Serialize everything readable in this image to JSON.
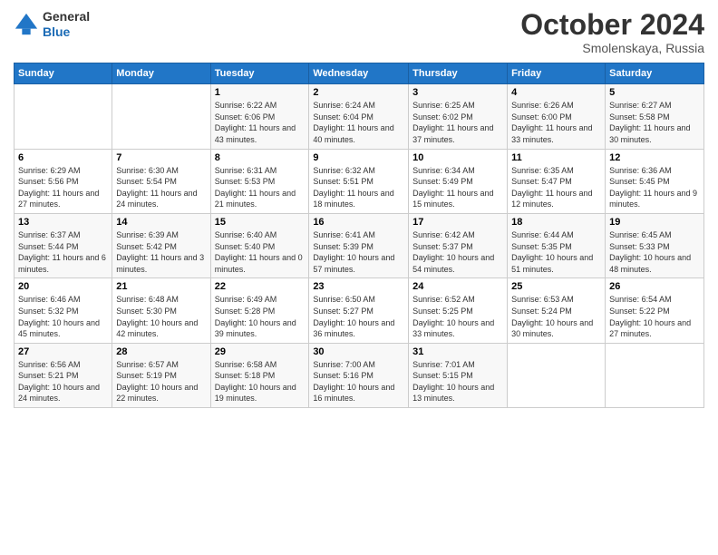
{
  "header": {
    "logo": {
      "general": "General",
      "blue": "Blue"
    },
    "title": "October 2024",
    "location": "Smolenskaya, Russia"
  },
  "weekdays": [
    "Sunday",
    "Monday",
    "Tuesday",
    "Wednesday",
    "Thursday",
    "Friday",
    "Saturday"
  ],
  "weeks": [
    [
      {
        "day": "",
        "sunrise": "",
        "sunset": "",
        "daylight": ""
      },
      {
        "day": "",
        "sunrise": "",
        "sunset": "",
        "daylight": ""
      },
      {
        "day": "1",
        "sunrise": "Sunrise: 6:22 AM",
        "sunset": "Sunset: 6:06 PM",
        "daylight": "Daylight: 11 hours and 43 minutes."
      },
      {
        "day": "2",
        "sunrise": "Sunrise: 6:24 AM",
        "sunset": "Sunset: 6:04 PM",
        "daylight": "Daylight: 11 hours and 40 minutes."
      },
      {
        "day": "3",
        "sunrise": "Sunrise: 6:25 AM",
        "sunset": "Sunset: 6:02 PM",
        "daylight": "Daylight: 11 hours and 37 minutes."
      },
      {
        "day": "4",
        "sunrise": "Sunrise: 6:26 AM",
        "sunset": "Sunset: 6:00 PM",
        "daylight": "Daylight: 11 hours and 33 minutes."
      },
      {
        "day": "5",
        "sunrise": "Sunrise: 6:27 AM",
        "sunset": "Sunset: 5:58 PM",
        "daylight": "Daylight: 11 hours and 30 minutes."
      }
    ],
    [
      {
        "day": "6",
        "sunrise": "Sunrise: 6:29 AM",
        "sunset": "Sunset: 5:56 PM",
        "daylight": "Daylight: 11 hours and 27 minutes."
      },
      {
        "day": "7",
        "sunrise": "Sunrise: 6:30 AM",
        "sunset": "Sunset: 5:54 PM",
        "daylight": "Daylight: 11 hours and 24 minutes."
      },
      {
        "day": "8",
        "sunrise": "Sunrise: 6:31 AM",
        "sunset": "Sunset: 5:53 PM",
        "daylight": "Daylight: 11 hours and 21 minutes."
      },
      {
        "day": "9",
        "sunrise": "Sunrise: 6:32 AM",
        "sunset": "Sunset: 5:51 PM",
        "daylight": "Daylight: 11 hours and 18 minutes."
      },
      {
        "day": "10",
        "sunrise": "Sunrise: 6:34 AM",
        "sunset": "Sunset: 5:49 PM",
        "daylight": "Daylight: 11 hours and 15 minutes."
      },
      {
        "day": "11",
        "sunrise": "Sunrise: 6:35 AM",
        "sunset": "Sunset: 5:47 PM",
        "daylight": "Daylight: 11 hours and 12 minutes."
      },
      {
        "day": "12",
        "sunrise": "Sunrise: 6:36 AM",
        "sunset": "Sunset: 5:45 PM",
        "daylight": "Daylight: 11 hours and 9 minutes."
      }
    ],
    [
      {
        "day": "13",
        "sunrise": "Sunrise: 6:37 AM",
        "sunset": "Sunset: 5:44 PM",
        "daylight": "Daylight: 11 hours and 6 minutes."
      },
      {
        "day": "14",
        "sunrise": "Sunrise: 6:39 AM",
        "sunset": "Sunset: 5:42 PM",
        "daylight": "Daylight: 11 hours and 3 minutes."
      },
      {
        "day": "15",
        "sunrise": "Sunrise: 6:40 AM",
        "sunset": "Sunset: 5:40 PM",
        "daylight": "Daylight: 11 hours and 0 minutes."
      },
      {
        "day": "16",
        "sunrise": "Sunrise: 6:41 AM",
        "sunset": "Sunset: 5:39 PM",
        "daylight": "Daylight: 10 hours and 57 minutes."
      },
      {
        "day": "17",
        "sunrise": "Sunrise: 6:42 AM",
        "sunset": "Sunset: 5:37 PM",
        "daylight": "Daylight: 10 hours and 54 minutes."
      },
      {
        "day": "18",
        "sunrise": "Sunrise: 6:44 AM",
        "sunset": "Sunset: 5:35 PM",
        "daylight": "Daylight: 10 hours and 51 minutes."
      },
      {
        "day": "19",
        "sunrise": "Sunrise: 6:45 AM",
        "sunset": "Sunset: 5:33 PM",
        "daylight": "Daylight: 10 hours and 48 minutes."
      }
    ],
    [
      {
        "day": "20",
        "sunrise": "Sunrise: 6:46 AM",
        "sunset": "Sunset: 5:32 PM",
        "daylight": "Daylight: 10 hours and 45 minutes."
      },
      {
        "day": "21",
        "sunrise": "Sunrise: 6:48 AM",
        "sunset": "Sunset: 5:30 PM",
        "daylight": "Daylight: 10 hours and 42 minutes."
      },
      {
        "day": "22",
        "sunrise": "Sunrise: 6:49 AM",
        "sunset": "Sunset: 5:28 PM",
        "daylight": "Daylight: 10 hours and 39 minutes."
      },
      {
        "day": "23",
        "sunrise": "Sunrise: 6:50 AM",
        "sunset": "Sunset: 5:27 PM",
        "daylight": "Daylight: 10 hours and 36 minutes."
      },
      {
        "day": "24",
        "sunrise": "Sunrise: 6:52 AM",
        "sunset": "Sunset: 5:25 PM",
        "daylight": "Daylight: 10 hours and 33 minutes."
      },
      {
        "day": "25",
        "sunrise": "Sunrise: 6:53 AM",
        "sunset": "Sunset: 5:24 PM",
        "daylight": "Daylight: 10 hours and 30 minutes."
      },
      {
        "day": "26",
        "sunrise": "Sunrise: 6:54 AM",
        "sunset": "Sunset: 5:22 PM",
        "daylight": "Daylight: 10 hours and 27 minutes."
      }
    ],
    [
      {
        "day": "27",
        "sunrise": "Sunrise: 6:56 AM",
        "sunset": "Sunset: 5:21 PM",
        "daylight": "Daylight: 10 hours and 24 minutes."
      },
      {
        "day": "28",
        "sunrise": "Sunrise: 6:57 AM",
        "sunset": "Sunset: 5:19 PM",
        "daylight": "Daylight: 10 hours and 22 minutes."
      },
      {
        "day": "29",
        "sunrise": "Sunrise: 6:58 AM",
        "sunset": "Sunset: 5:18 PM",
        "daylight": "Daylight: 10 hours and 19 minutes."
      },
      {
        "day": "30",
        "sunrise": "Sunrise: 7:00 AM",
        "sunset": "Sunset: 5:16 PM",
        "daylight": "Daylight: 10 hours and 16 minutes."
      },
      {
        "day": "31",
        "sunrise": "Sunrise: 7:01 AM",
        "sunset": "Sunset: 5:15 PM",
        "daylight": "Daylight: 10 hours and 13 minutes."
      },
      {
        "day": "",
        "sunrise": "",
        "sunset": "",
        "daylight": ""
      },
      {
        "day": "",
        "sunrise": "",
        "sunset": "",
        "daylight": ""
      }
    ]
  ]
}
